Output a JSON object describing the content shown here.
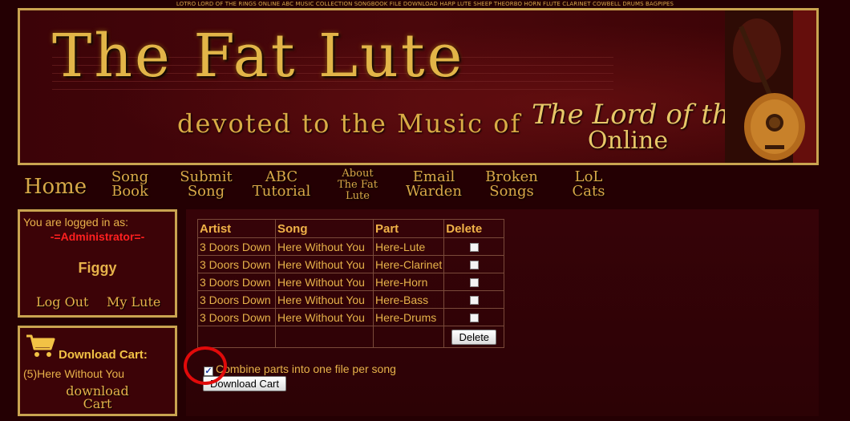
{
  "topline": "LOTRO LORD OF THE RINGS ONLINE ABC MUSIC COLLECTION SONGBOOK FILE DOWNLOAD HARP LUTE SHEEP THEORBO HORN FLUTE CLARINET COWBELL DRUMS BAGPIPES",
  "banner": {
    "title": "The Fat Lute",
    "subtitle": "devoted to the Music of",
    "logo_line1": "The Lord of the Rings",
    "logo_line2": "Online"
  },
  "nav": [
    {
      "line1": "Home",
      "line2": "",
      "line3": ""
    },
    {
      "line1": "Song",
      "line2": "Book",
      "line3": ""
    },
    {
      "line1": "Submit",
      "line2": "Song",
      "line3": ""
    },
    {
      "line1": "ABC",
      "line2": "Tutorial",
      "line3": ""
    },
    {
      "line1": "About",
      "line2": "The Fat",
      "line3": "Lute"
    },
    {
      "line1": "Email",
      "line2": "Warden",
      "line3": ""
    },
    {
      "line1": "Broken",
      "line2": "Songs",
      "line3": ""
    },
    {
      "line1": "LoL",
      "line2": "Cats",
      "line3": ""
    }
  ],
  "login": {
    "label": "You are logged in as:",
    "role": "-=Administrator=-",
    "username": "Figgy",
    "logout": "Log Out",
    "mylute": "My Lute"
  },
  "cart": {
    "title": "Download Cart:",
    "item": "(5)Here Without You",
    "download_line1": "download",
    "download_line2": "Cart"
  },
  "table": {
    "headers": [
      "Artist",
      "Song",
      "Part",
      "Delete"
    ],
    "rows": [
      {
        "artist": "3 Doors Down",
        "song": "Here Without You",
        "part": "Here-Lute"
      },
      {
        "artist": "3 Doors Down",
        "song": "Here Without You",
        "part": "Here-Clarinet"
      },
      {
        "artist": "3 Doors Down",
        "song": "Here Without You",
        "part": "Here-Horn"
      },
      {
        "artist": "3 Doors Down",
        "song": "Here Without You",
        "part": "Here-Bass"
      },
      {
        "artist": "3 Doors Down",
        "song": "Here Without You",
        "part": "Here-Drums"
      }
    ],
    "delete_button": "Delete"
  },
  "combine": {
    "label": "Combine parts into one file per song",
    "checked": true
  },
  "download_cart_button": "Download Cart",
  "colors": {
    "gold": "#e6b24a",
    "admin_red": "#ff2020",
    "highlight_circle": "#e10a0a",
    "background": "#240003"
  }
}
